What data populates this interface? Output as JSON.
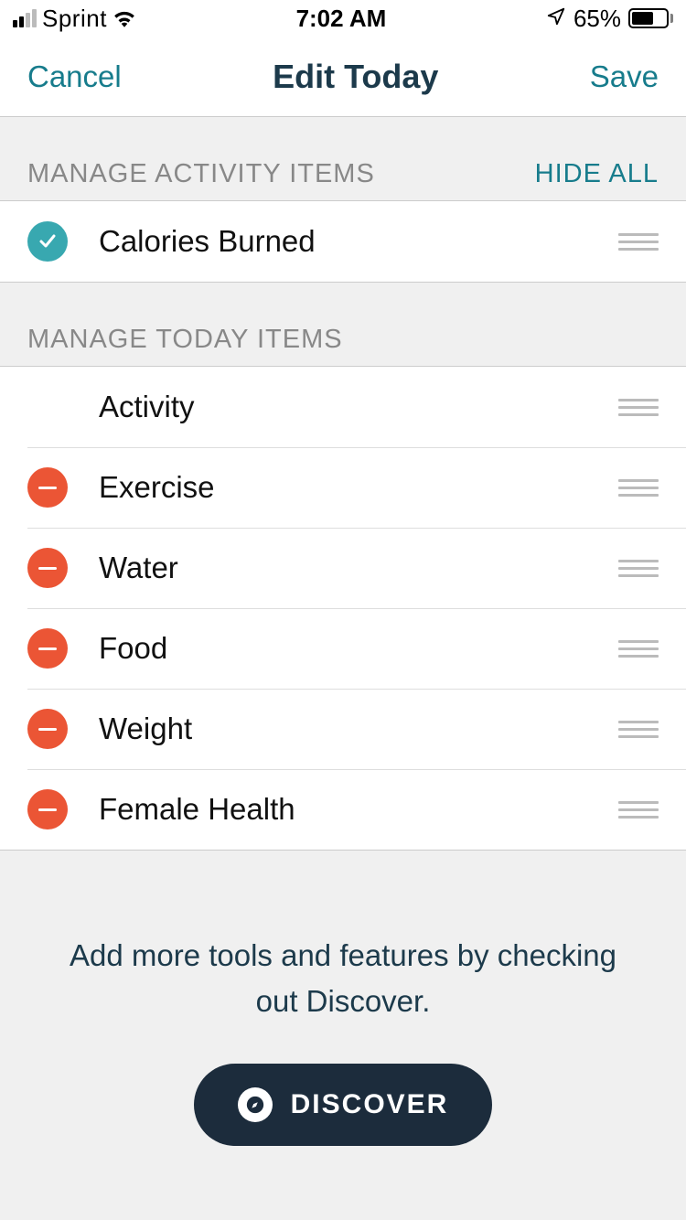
{
  "status_bar": {
    "carrier": "Sprint",
    "time": "7:02 AM",
    "battery_percent": "65%"
  },
  "nav": {
    "cancel": "Cancel",
    "title": "Edit Today",
    "save": "Save"
  },
  "sections": {
    "activity": {
      "title": "MANAGE ACTIVITY ITEMS",
      "action": "HIDE ALL",
      "items": [
        {
          "label": "Calories Burned",
          "icon": "check"
        }
      ]
    },
    "today": {
      "title": "MANAGE TODAY ITEMS",
      "items": [
        {
          "label": "Activity",
          "icon": "none"
        },
        {
          "label": "Exercise",
          "icon": "minus"
        },
        {
          "label": "Water",
          "icon": "minus"
        },
        {
          "label": "Food",
          "icon": "minus"
        },
        {
          "label": "Weight",
          "icon": "minus"
        },
        {
          "label": "Female Health",
          "icon": "minus"
        }
      ]
    }
  },
  "discover": {
    "text": "Add more tools and features by checking out Discover.",
    "button": "DISCOVER"
  }
}
